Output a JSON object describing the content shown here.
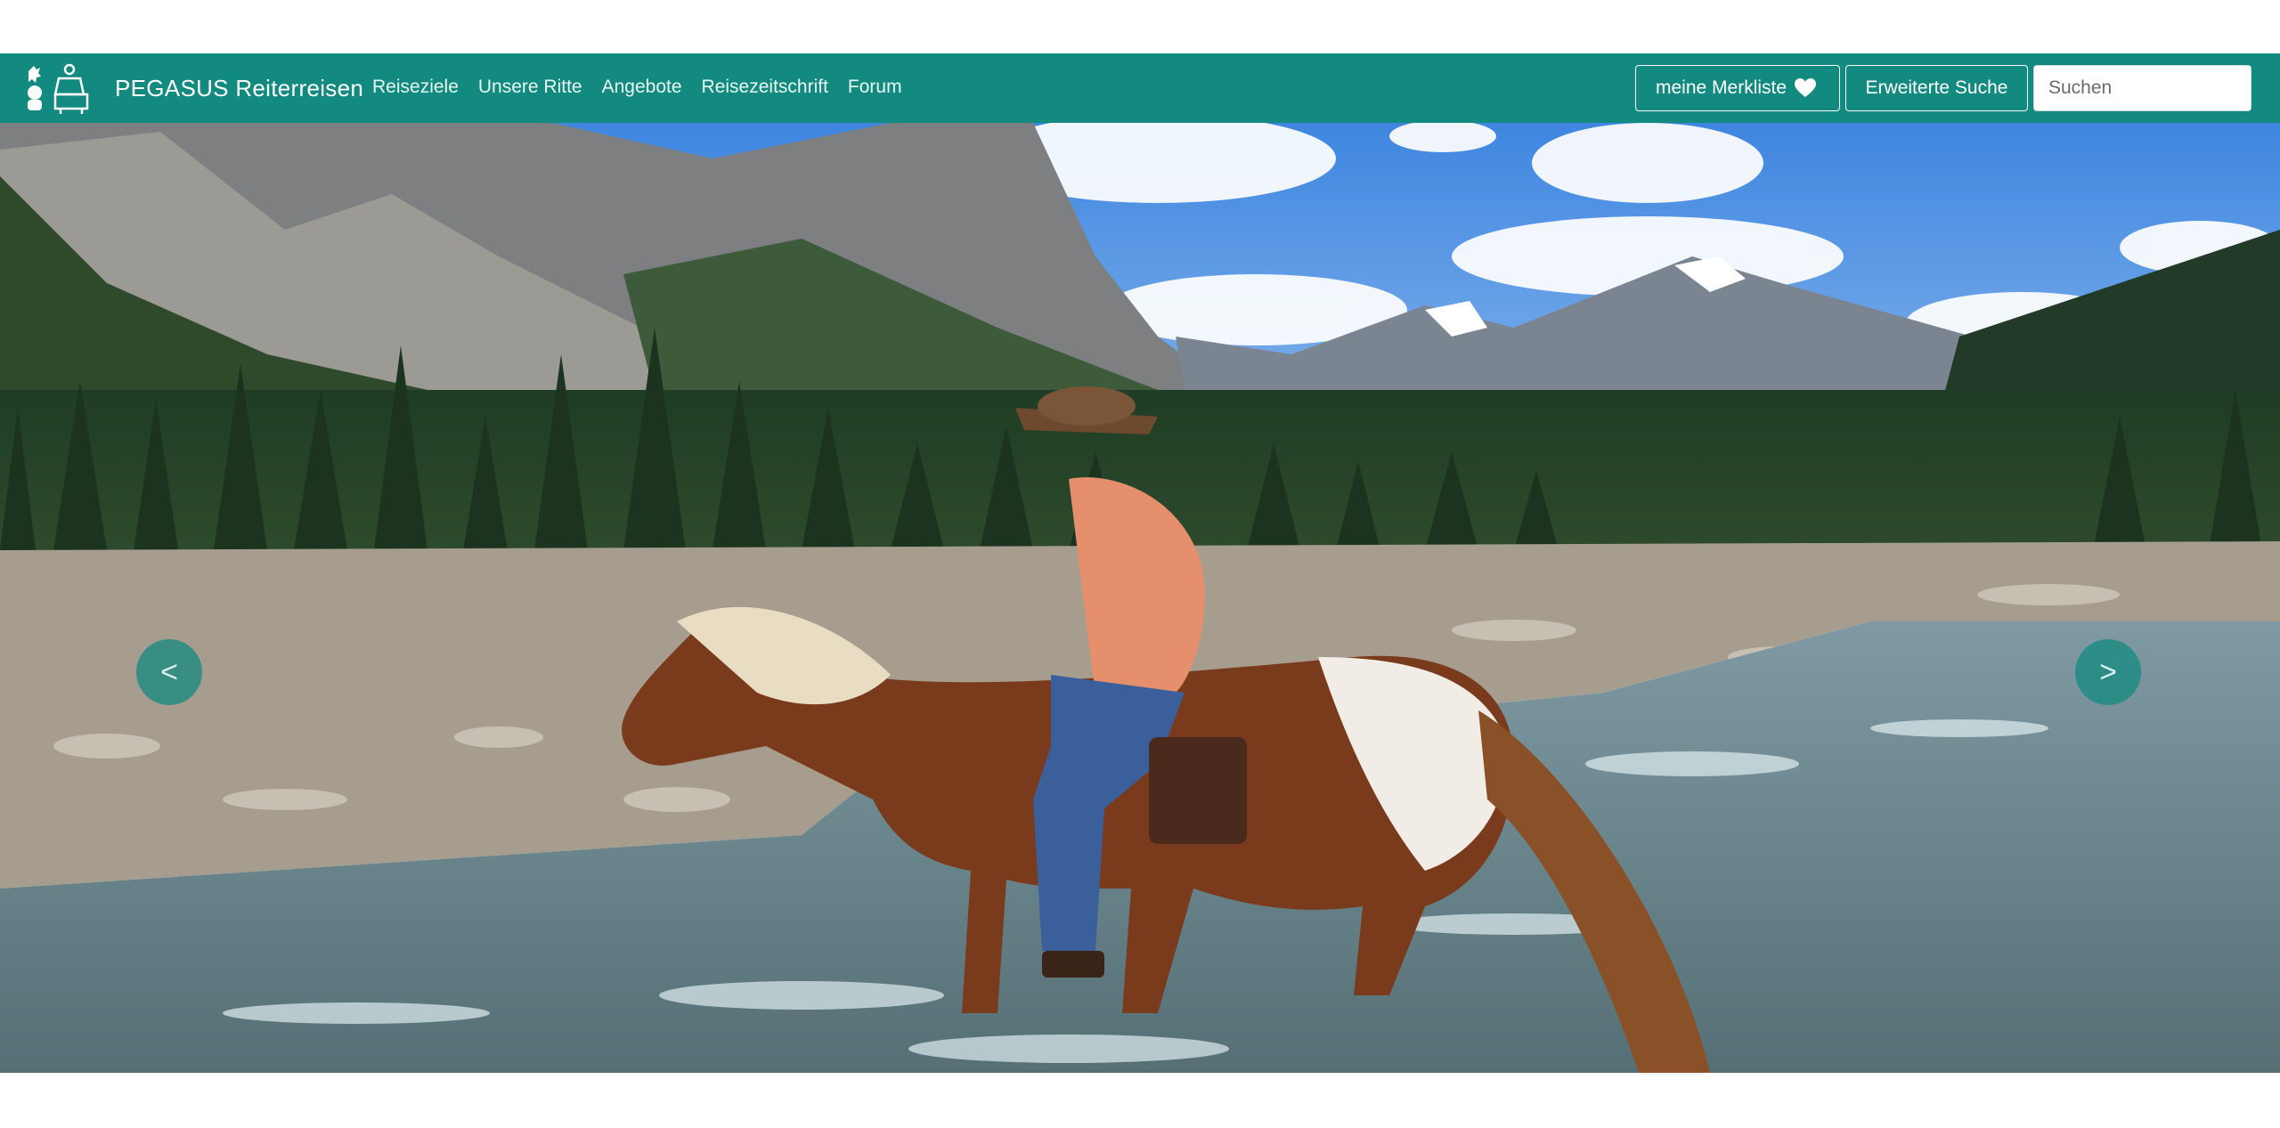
{
  "brand": {
    "name": "PEGASUS Reiterreisen",
    "logo_icon": "horse-and-rider-logo-icon"
  },
  "nav": {
    "links": [
      {
        "label": "Reiseziele"
      },
      {
        "label": "Unsere Ritte"
      },
      {
        "label": "Angebote"
      },
      {
        "label": "Reisezeitschrift"
      },
      {
        "label": "Forum"
      }
    ]
  },
  "actions": {
    "merkliste_label": "meine Merkliste",
    "merkliste_icon": "heart-icon",
    "advanced_search_label": "Erweiterte Suche",
    "search_placeholder": "Suchen",
    "search_value": ""
  },
  "carousel": {
    "prev_label": "<",
    "next_label": ">",
    "slide_count": 3,
    "active_slide": 1,
    "slide_description_icon": "hero-photo-rider-crossing-river"
  },
  "colors": {
    "nav_bg": "#138a7f",
    "accent": "#138a7f",
    "text_light": "#ffffff"
  }
}
